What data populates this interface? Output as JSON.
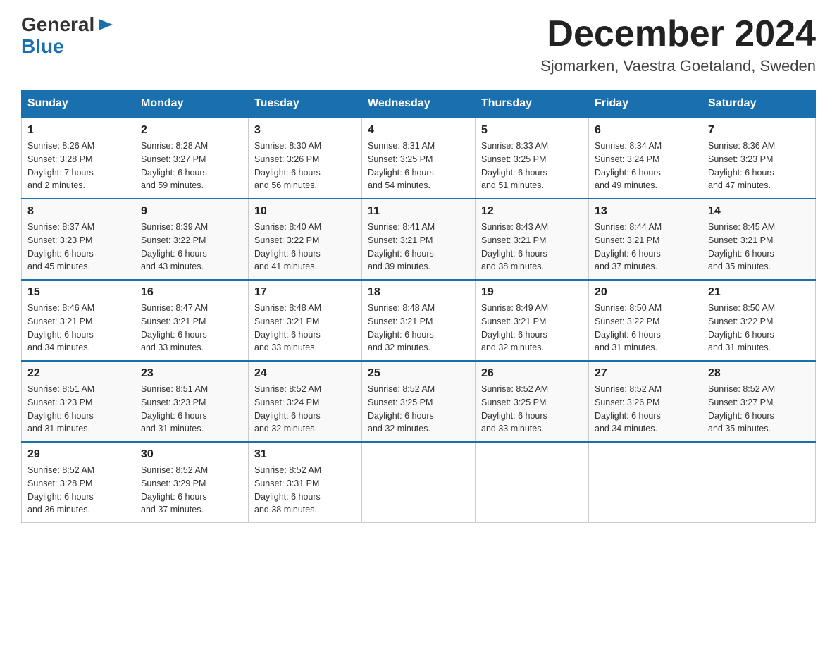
{
  "header": {
    "logo": {
      "general": "General",
      "blue": "Blue",
      "arrow_symbol": "▶"
    },
    "title": "December 2024",
    "subtitle": "Sjomarken, Vaestra Goetaland, Sweden"
  },
  "weekdays": [
    "Sunday",
    "Monday",
    "Tuesday",
    "Wednesday",
    "Thursday",
    "Friday",
    "Saturday"
  ],
  "weeks": [
    [
      {
        "day": "1",
        "sunrise": "8:26 AM",
        "sunset": "3:28 PM",
        "daylight": "7 hours and 2 minutes."
      },
      {
        "day": "2",
        "sunrise": "8:28 AM",
        "sunset": "3:27 PM",
        "daylight": "6 hours and 59 minutes."
      },
      {
        "day": "3",
        "sunrise": "8:30 AM",
        "sunset": "3:26 PM",
        "daylight": "6 hours and 56 minutes."
      },
      {
        "day": "4",
        "sunrise": "8:31 AM",
        "sunset": "3:25 PM",
        "daylight": "6 hours and 54 minutes."
      },
      {
        "day": "5",
        "sunrise": "8:33 AM",
        "sunset": "3:25 PM",
        "daylight": "6 hours and 51 minutes."
      },
      {
        "day": "6",
        "sunrise": "8:34 AM",
        "sunset": "3:24 PM",
        "daylight": "6 hours and 49 minutes."
      },
      {
        "day": "7",
        "sunrise": "8:36 AM",
        "sunset": "3:23 PM",
        "daylight": "6 hours and 47 minutes."
      }
    ],
    [
      {
        "day": "8",
        "sunrise": "8:37 AM",
        "sunset": "3:23 PM",
        "daylight": "6 hours and 45 minutes."
      },
      {
        "day": "9",
        "sunrise": "8:39 AM",
        "sunset": "3:22 PM",
        "daylight": "6 hours and 43 minutes."
      },
      {
        "day": "10",
        "sunrise": "8:40 AM",
        "sunset": "3:22 PM",
        "daylight": "6 hours and 41 minutes."
      },
      {
        "day": "11",
        "sunrise": "8:41 AM",
        "sunset": "3:21 PM",
        "daylight": "6 hours and 39 minutes."
      },
      {
        "day": "12",
        "sunrise": "8:43 AM",
        "sunset": "3:21 PM",
        "daylight": "6 hours and 38 minutes."
      },
      {
        "day": "13",
        "sunrise": "8:44 AM",
        "sunset": "3:21 PM",
        "daylight": "6 hours and 37 minutes."
      },
      {
        "day": "14",
        "sunrise": "8:45 AM",
        "sunset": "3:21 PM",
        "daylight": "6 hours and 35 minutes."
      }
    ],
    [
      {
        "day": "15",
        "sunrise": "8:46 AM",
        "sunset": "3:21 PM",
        "daylight": "6 hours and 34 minutes."
      },
      {
        "day": "16",
        "sunrise": "8:47 AM",
        "sunset": "3:21 PM",
        "daylight": "6 hours and 33 minutes."
      },
      {
        "day": "17",
        "sunrise": "8:48 AM",
        "sunset": "3:21 PM",
        "daylight": "6 hours and 33 minutes."
      },
      {
        "day": "18",
        "sunrise": "8:48 AM",
        "sunset": "3:21 PM",
        "daylight": "6 hours and 32 minutes."
      },
      {
        "day": "19",
        "sunrise": "8:49 AM",
        "sunset": "3:21 PM",
        "daylight": "6 hours and 32 minutes."
      },
      {
        "day": "20",
        "sunrise": "8:50 AM",
        "sunset": "3:22 PM",
        "daylight": "6 hours and 31 minutes."
      },
      {
        "day": "21",
        "sunrise": "8:50 AM",
        "sunset": "3:22 PM",
        "daylight": "6 hours and 31 minutes."
      }
    ],
    [
      {
        "day": "22",
        "sunrise": "8:51 AM",
        "sunset": "3:23 PM",
        "daylight": "6 hours and 31 minutes."
      },
      {
        "day": "23",
        "sunrise": "8:51 AM",
        "sunset": "3:23 PM",
        "daylight": "6 hours and 31 minutes."
      },
      {
        "day": "24",
        "sunrise": "8:52 AM",
        "sunset": "3:24 PM",
        "daylight": "6 hours and 32 minutes."
      },
      {
        "day": "25",
        "sunrise": "8:52 AM",
        "sunset": "3:25 PM",
        "daylight": "6 hours and 32 minutes."
      },
      {
        "day": "26",
        "sunrise": "8:52 AM",
        "sunset": "3:25 PM",
        "daylight": "6 hours and 33 minutes."
      },
      {
        "day": "27",
        "sunrise": "8:52 AM",
        "sunset": "3:26 PM",
        "daylight": "6 hours and 34 minutes."
      },
      {
        "day": "28",
        "sunrise": "8:52 AM",
        "sunset": "3:27 PM",
        "daylight": "6 hours and 35 minutes."
      }
    ],
    [
      {
        "day": "29",
        "sunrise": "8:52 AM",
        "sunset": "3:28 PM",
        "daylight": "6 hours and 36 minutes."
      },
      {
        "day": "30",
        "sunrise": "8:52 AM",
        "sunset": "3:29 PM",
        "daylight": "6 hours and 37 minutes."
      },
      {
        "day": "31",
        "sunrise": "8:52 AM",
        "sunset": "3:31 PM",
        "daylight": "6 hours and 38 minutes."
      },
      null,
      null,
      null,
      null
    ]
  ],
  "labels": {
    "sunrise": "Sunrise:",
    "sunset": "Sunset:",
    "daylight": "Daylight:"
  }
}
